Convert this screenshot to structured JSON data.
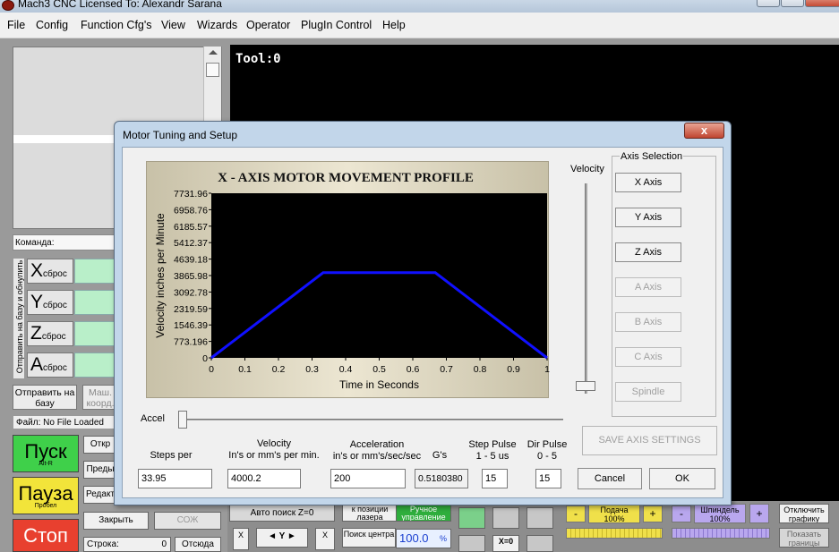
{
  "window": {
    "title": "Mach3 CNC  Licensed To: Alexandr Sarana"
  },
  "menu": [
    "File",
    "Config",
    "Function Cfg's",
    "View",
    "Wizards",
    "Operator",
    "PlugIn Control",
    "Help"
  ],
  "toolpath": {
    "tool_label": "Tool:0"
  },
  "left_panel": {
    "command_label": "Команда:",
    "vertical_label": "Отправить на базу и обнулить",
    "axes": [
      {
        "letter": "X",
        "suffix": "сброс"
      },
      {
        "letter": "Y",
        "suffix": "сброс"
      },
      {
        "letter": "Z",
        "suffix": "сброс"
      },
      {
        "letter": "A",
        "suffix": "сброс"
      }
    ],
    "send_home_label": "Отправить на базу",
    "machine_coords_label": "Маш. коорд.",
    "file_label": "Файл:  No File Loaded",
    "start_label": "Пуск",
    "start_hotkey": "Alt-R",
    "pause_label": "Пауза",
    "pause_hotkey": "Пробел",
    "stop_label": "Стоп",
    "open_label": "Откр",
    "prev_label": "Преды",
    "edit_label": "Редакт",
    "close_label": "Закрыть",
    "reset_label": "СОЖ",
    "line_label": "Строка:",
    "line_value": "0",
    "from_label": "Отсюда"
  },
  "bottom_controls": {
    "auto_z_label": "Авто поиск Z=0",
    "laser_label": "к позиции лазера",
    "manual_label": "Ручное управление",
    "center_label": "Поиск центра",
    "y_jog_label": "◄ Y ►",
    "x_jog_label": "X",
    "feed_percent": "100.0",
    "percent_sign": "%",
    "feed_label": "Подача 100%",
    "spindle_label": "Шпиндель 100%",
    "minus": "-",
    "plus": "+",
    "xzero_label": "X=0",
    "disable_graphics_label": "Отключить графику",
    "show_bounds_label": "Показать границы"
  },
  "dialog": {
    "title": "Motor Tuning and Setup",
    "close_glyph": "x",
    "velocity_label": "Velocity",
    "accel_label": "Accel",
    "axis_selection_label": "Axis Selection",
    "axis_buttons": [
      {
        "label": "X Axis",
        "enabled": true
      },
      {
        "label": "Y Axis",
        "enabled": true
      },
      {
        "label": "Z Axis",
        "enabled": true
      },
      {
        "label": "A Axis",
        "enabled": false
      },
      {
        "label": "B Axis",
        "enabled": false
      },
      {
        "label": "C Axis",
        "enabled": false
      },
      {
        "label": "Spindle",
        "enabled": false
      }
    ],
    "save_label": "SAVE AXIS SETTINGS",
    "cancel_label": "Cancel",
    "ok_label": "OK",
    "fields": {
      "steps_label": "Steps per",
      "steps_value": "33.95",
      "velocity_label_1": "Velocity",
      "velocity_label_2": "In's or mm's per min.",
      "velocity_value": "4000.2",
      "accel_label_1": "Acceleration",
      "accel_label_2": "in's or mm's/sec/sec",
      "accel_value": "200",
      "gs_label": "G's",
      "gs_value": "0.5180380",
      "step_pulse_label_1": "Step Pulse",
      "step_pulse_label_2": "1 - 5 us",
      "step_pulse_value": "15",
      "dir_pulse_label_1": "Dir Pulse",
      "dir_pulse_label_2": "0 - 5",
      "dir_pulse_value": "15"
    }
  },
  "chart_data": {
    "type": "line",
    "title": "X - AXIS MOTOR MOVEMENT PROFILE",
    "xlabel": "Time in Seconds",
    "ylabel": "Velocity inches per Minute",
    "x_ticks": [
      "0",
      "0.1",
      "0.2",
      "0.3",
      "0.4",
      "0.5",
      "0.6",
      "0.7",
      "0.8",
      "0.9",
      "1"
    ],
    "y_ticks": [
      "0",
      "773.196",
      "1546.39",
      "2319.59",
      "3092.78",
      "3865.98",
      "4639.18",
      "5412.37",
      "6185.57",
      "6958.76",
      "7731.96"
    ],
    "xlim": [
      0,
      1
    ],
    "ylim": [
      0,
      7731.96
    ],
    "series": [
      {
        "x": [
          0,
          0.333,
          0.667,
          1
        ],
        "y": [
          0,
          4000.2,
          4000.2,
          0
        ],
        "color": "#1010ff"
      }
    ],
    "background": "#000000"
  }
}
